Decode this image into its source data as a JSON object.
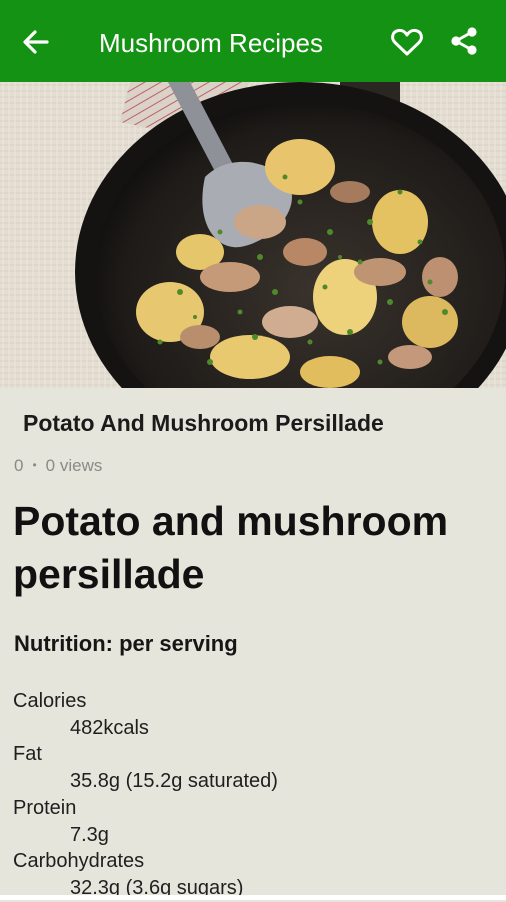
{
  "app_bar": {
    "title": "Mushroom Recipes",
    "background": "#149214",
    "icons": [
      "arrow-back-icon",
      "heart-outline-icon",
      "share-icon"
    ]
  },
  "hero_image": {
    "alt": "Potato and mushroom persillade in a pan"
  },
  "recipe": {
    "heading": "Potato And Mushroom Persillade",
    "likes": "0",
    "separator": "•",
    "views": "0 views",
    "title": "Potato and mushroom persillade"
  },
  "nutrition": {
    "heading": "Nutrition: per serving",
    "items": [
      {
        "label": "Calories",
        "value": "482kcals"
      },
      {
        "label": "Fat",
        "value": "35.8g (15.2g saturated)"
      },
      {
        "label": "Protein",
        "value": "7.3g"
      },
      {
        "label": "Carbohydrates",
        "value": "32.3g (3.6g sugars)"
      }
    ]
  }
}
